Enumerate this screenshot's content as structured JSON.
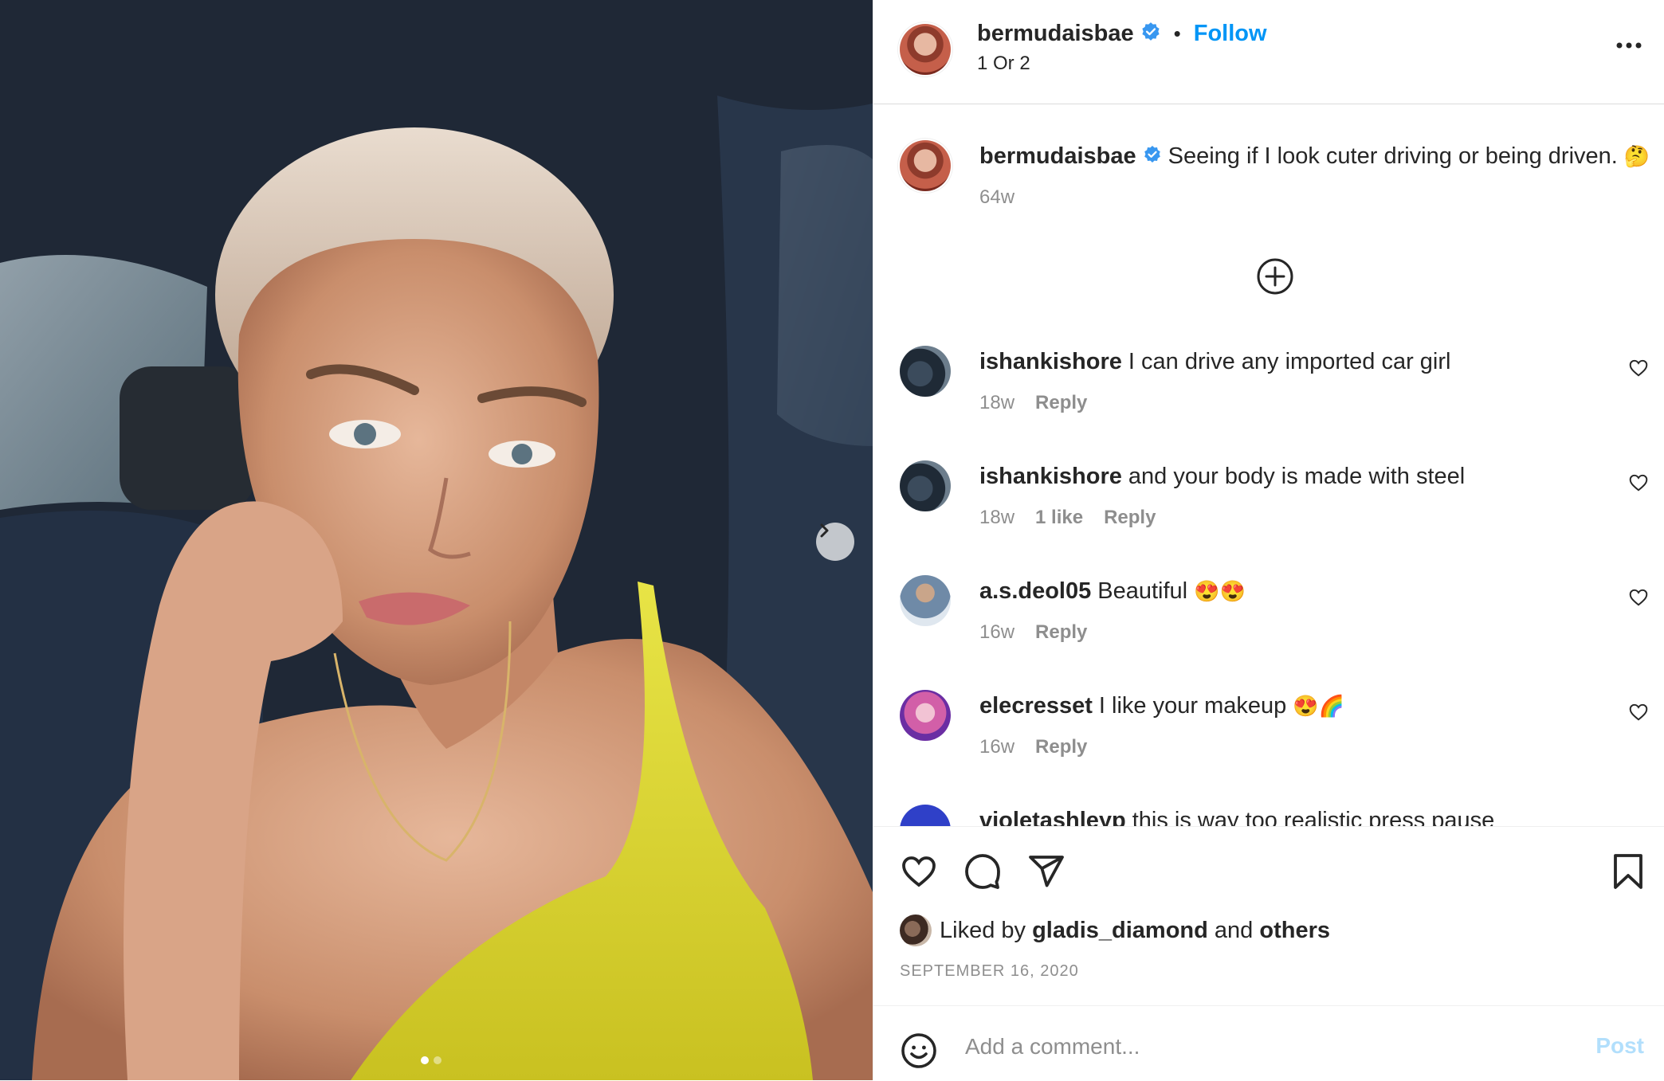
{
  "post": {
    "image_description_icon": "photo-of-woman-in-car",
    "carousel_dots": 2,
    "carousel_active_index": 0
  },
  "header": {
    "username": "bermudaisbae",
    "separator": "•",
    "follow_label": "Follow",
    "subtitle": "1 Or 2"
  },
  "caption": {
    "username": "bermudaisbae",
    "text": "Seeing if I look cuter driving or being driven.",
    "emoji": "🤔",
    "age": "64w"
  },
  "comments": [
    {
      "username": "ishankishore",
      "text": "I can drive any imported car girl",
      "age": "18w",
      "likes": "",
      "reply": "Reply"
    },
    {
      "username": "ishankishore",
      "text": "and your body is made with steel",
      "age": "18w",
      "likes": "1 like",
      "reply": "Reply"
    },
    {
      "username": "a.s.deol05",
      "text": "Beautiful",
      "emoji": "😍😍",
      "age": "16w",
      "likes": "",
      "reply": "Reply"
    },
    {
      "username": "elecresset",
      "text": "I like your makeup",
      "emoji": "😍🌈",
      "age": "16w",
      "likes": "",
      "reply": "Reply"
    },
    {
      "username": "violetashleyp",
      "text": "this is way too realistic press pause"
    }
  ],
  "likes": {
    "prefix": "Liked by",
    "user": "gladis_diamond",
    "conjunction": "and",
    "others": "others"
  },
  "date": "SEPTEMBER 16, 2020",
  "composer": {
    "placeholder": "Add a comment...",
    "post_label": "Post"
  },
  "colors": {
    "accent": "#0095f6",
    "verified": "#3897f0",
    "muted": "#8e8e8e",
    "post_disabled": "#b2dffc"
  }
}
